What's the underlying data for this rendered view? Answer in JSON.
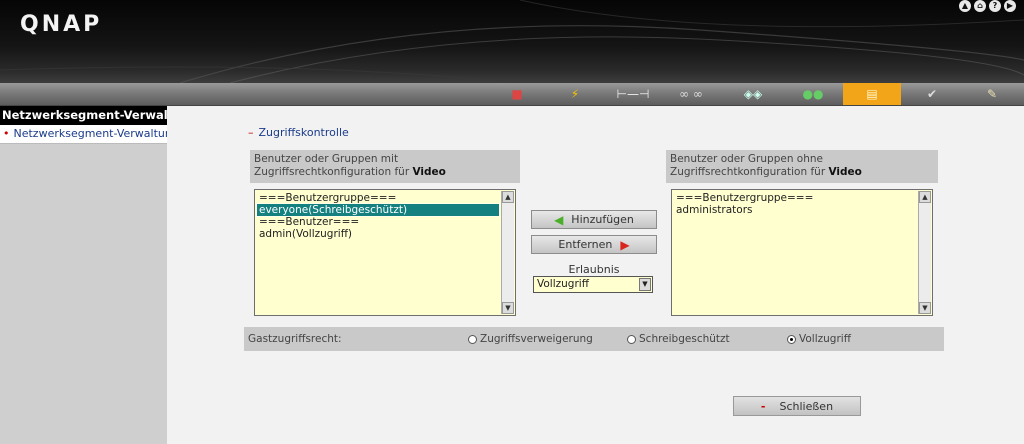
{
  "app": {
    "logo": "QNAP"
  },
  "top_icons": [
    "up-icon",
    "home-icon",
    "help-icon",
    "logout-icon"
  ],
  "toolbar": {
    "items": [
      {
        "icon": "system-admin-icon"
      },
      {
        "icon": "disk-management-icon"
      },
      {
        "icon": "access-rights-icon"
      },
      {
        "icon": "network-services-icon"
      },
      {
        "icon": "applications-icon"
      },
      {
        "icon": "backup-icon"
      },
      {
        "icon": "external-device-icon",
        "active": true
      },
      {
        "icon": "system-status-icon"
      },
      {
        "icon": "logs-icon"
      }
    ],
    "active_color": "#f3a51a"
  },
  "sidebar": {
    "title": "Netzwerksegment-Verwaltung",
    "items": [
      {
        "label": "Netzwerksegment-Verwaltung"
      }
    ]
  },
  "main": {
    "section_label": "Zugriffskontrolle",
    "with_access": {
      "header_prefix": "Benutzer oder Gruppen mit Zugriffsrechtkonfiguration für",
      "share_name": "Video",
      "items": [
        {
          "text": "===Benutzergruppe===",
          "selected": false
        },
        {
          "text": "everyone(Schreibgeschützt)",
          "selected": true
        },
        {
          "text": "===Benutzer===",
          "selected": false
        },
        {
          "text": "admin(Vollzugriff)",
          "selected": false
        }
      ]
    },
    "without_access": {
      "header_prefix": "Benutzer oder Gruppen ohne Zugriffsrechtkonfiguration für",
      "share_name": "Video",
      "items": [
        {
          "text": "===Benutzergruppe===",
          "selected": false
        },
        {
          "text": "administrators",
          "selected": false
        }
      ]
    },
    "add_button": "Hinzufügen",
    "remove_button": "Entfernen",
    "permission_label": "Erlaubnis",
    "permission_value": "Vollzugriff",
    "guest": {
      "label": "Gastzugriffsrecht:",
      "options": [
        {
          "label": "Zugriffsverweigerung",
          "checked": false
        },
        {
          "label": "Schreibgeschützt",
          "checked": false
        },
        {
          "label": "Vollzugriff",
          "checked": true
        }
      ]
    },
    "close_button": "Schließen"
  }
}
